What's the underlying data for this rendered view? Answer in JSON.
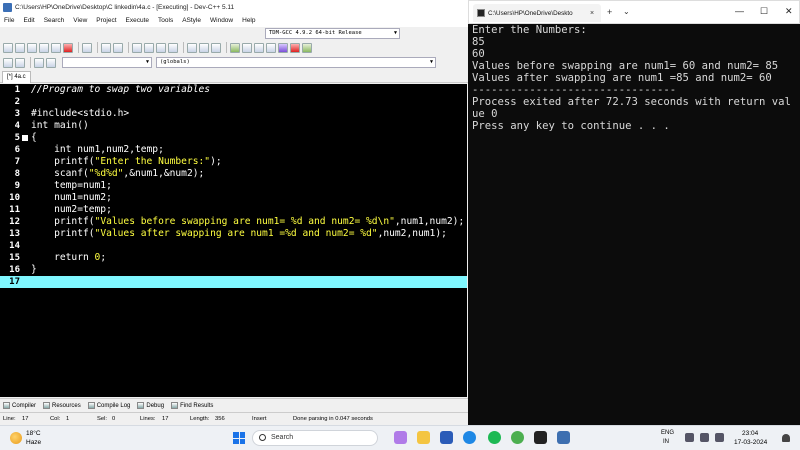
{
  "ide": {
    "title": "C:\\Users\\HP\\OneDrive\\Desktop\\C linkedin\\4a.c - [Executing] - Dev-C++ 5.11",
    "menu": [
      "File",
      "Edit",
      "Search",
      "View",
      "Project",
      "Execute",
      "Tools",
      "AStyle",
      "Window",
      "Help"
    ],
    "compiler_select": "TDM-GCC 4.9.2 64-bit Release",
    "scope_select": "(globals)",
    "tab_label": "[*] 4a.c",
    "lines": [
      {
        "n": "1",
        "text": "//Program to swap two variables"
      },
      {
        "n": "2",
        "text": ""
      },
      {
        "n": "3",
        "text": "#include<stdio.h>"
      },
      {
        "n": "4",
        "text": "int main()"
      },
      {
        "n": "5",
        "text": "{"
      },
      {
        "n": "6",
        "text": "    int num1,num2,temp;"
      },
      {
        "n": "7",
        "text": "    printf(\"Enter the Numbers:\");"
      },
      {
        "n": "8",
        "text": "    scanf(\"%d%d\",&num1,&num2);"
      },
      {
        "n": "9",
        "text": "    temp=num1;"
      },
      {
        "n": "10",
        "text": "    num1=num2;"
      },
      {
        "n": "11",
        "text": "    num2=temp;"
      },
      {
        "n": "12",
        "text": "    printf(\"Values before swapping are num1= %d and num2= %d\\n\",num1,num2);"
      },
      {
        "n": "13",
        "text": "    printf(\"Values after swapping are num1 =%d and num2= %d\",num2,num1);"
      },
      {
        "n": "14",
        "text": ""
      },
      {
        "n": "15",
        "text": "    return 0;"
      },
      {
        "n": "16",
        "text": "}"
      },
      {
        "n": "17",
        "text": ""
      }
    ],
    "panels": [
      "Compiler",
      "Resources",
      "Compile Log",
      "Debug",
      "Find Results"
    ],
    "status": {
      "line": "Line:",
      "line_val": "17",
      "col": "Col:",
      "col_val": "1",
      "sel": "Sel:",
      "sel_val": "0",
      "lines": "Lines:",
      "lines_val": "17",
      "length": "Length:",
      "length_val": "356",
      "mode": "Insert",
      "message": "Done parsing in 0.047 seconds"
    }
  },
  "console": {
    "tab_title": "C:\\Users\\HP\\OneDrive\\Deskto",
    "tab_close": "×",
    "add_tab": "+",
    "dropdown": "⌄",
    "minimize": "—",
    "maximize": "☐",
    "close": "✕",
    "output": [
      "Enter the Numbers:",
      "85",
      "60",
      "Values before swapping are num1= 60 and num2= 85",
      "Values after swapping are num1 =85 and num2= 60",
      "--------------------------------",
      "Process exited after 72.73 seconds with return val",
      "ue 0",
      "Press any key to continue . . ."
    ]
  },
  "taskbar": {
    "weather_temp": "18°C",
    "weather_cond": "Haze",
    "search_placeholder": "Search",
    "lang_1": "ENG",
    "lang_2": "IN",
    "time": "23:04",
    "date": "17-03-2024"
  },
  "colors": {
    "active_line": "#7ff7ff",
    "string": "#ffff40",
    "preprocessor": "#2e8b57",
    "comment": "#9aa0a8",
    "console_bg": "#0c0c0c"
  }
}
